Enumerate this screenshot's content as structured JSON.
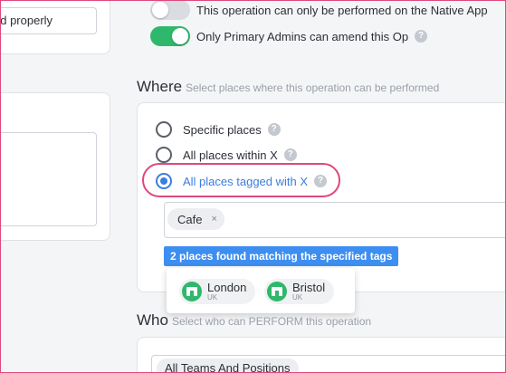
{
  "left": {
    "input_value": "ed properly"
  },
  "toggles": [
    {
      "label": "This operation can only be performed on the Native App",
      "state": "off"
    },
    {
      "label": "Only Primary Admins can amend this Op",
      "state": "on"
    }
  ],
  "where": {
    "title": "Where",
    "subtitle": "Select places where this operation can be performed",
    "options": [
      {
        "label": "Specific places",
        "selected": false
      },
      {
        "label": "All places within X",
        "selected": false
      },
      {
        "label": "All places tagged with X",
        "selected": true
      }
    ],
    "tags": [
      {
        "label": "Cafe",
        "remove": "×"
      }
    ],
    "found_text": "2 places found matching the specified tags",
    "places": [
      {
        "name": "London",
        "country": "UK"
      },
      {
        "name": "Bristol",
        "country": "UK"
      }
    ]
  },
  "who": {
    "title": "Who",
    "subtitle": "Select who can PERFORM this operation",
    "selected": "All Teams And Positions"
  },
  "help_glyph": "?",
  "colors": {
    "accent": "#3b7de0",
    "banner": "#3d8ef0",
    "toggle_on": "#2fb86b",
    "highlight": "#e0487a"
  },
  "icons": [
    "help-icon",
    "store-icon",
    "close-icon"
  ]
}
